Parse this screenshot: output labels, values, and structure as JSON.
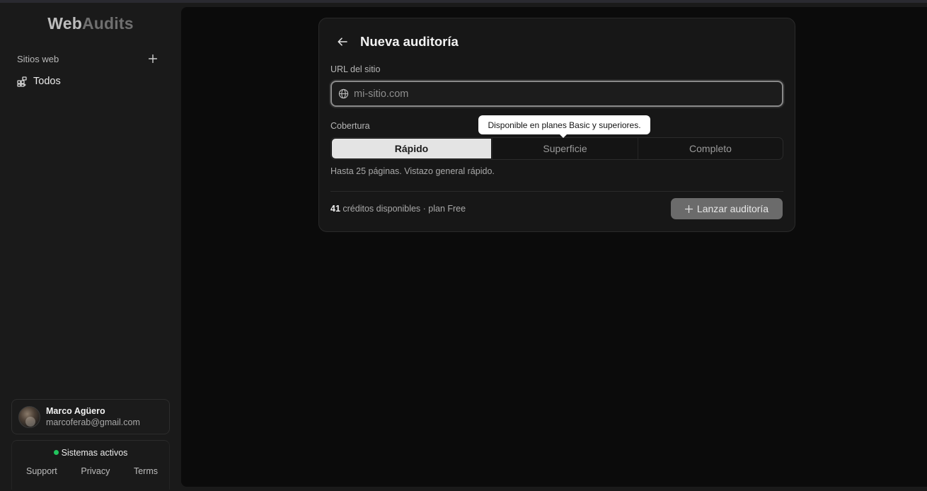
{
  "app": {
    "logo_part1": "Web",
    "logo_part2": "Audits"
  },
  "sidebar": {
    "section_label": "Sitios web",
    "items": [
      {
        "label": "Todos",
        "icon": "grid-plus-icon"
      }
    ]
  },
  "user": {
    "name": "Marco Agüero",
    "email": "marcoferab@gmail.com"
  },
  "status": {
    "text": "Sistemas activos",
    "color": "#22c55e"
  },
  "footer": {
    "links": [
      "Support",
      "Privacy",
      "Terms"
    ]
  },
  "form": {
    "title": "Nueva auditoría",
    "url_label": "URL del sitio",
    "url_value": "",
    "url_placeholder": "mi-sitio.com",
    "coverage_label": "Cobertura",
    "coverage_options": [
      "Rápido",
      "Superficie",
      "Completo"
    ],
    "coverage_selected": "Rápido",
    "tooltip": "Disponible en planes Basic y superiores.",
    "hint": "Hasta 25 páginas. Vistazo general rápido.",
    "credits_count": "41",
    "credits_text": "créditos disponibles · plan Free",
    "launch_label": "Lanzar auditoría"
  }
}
